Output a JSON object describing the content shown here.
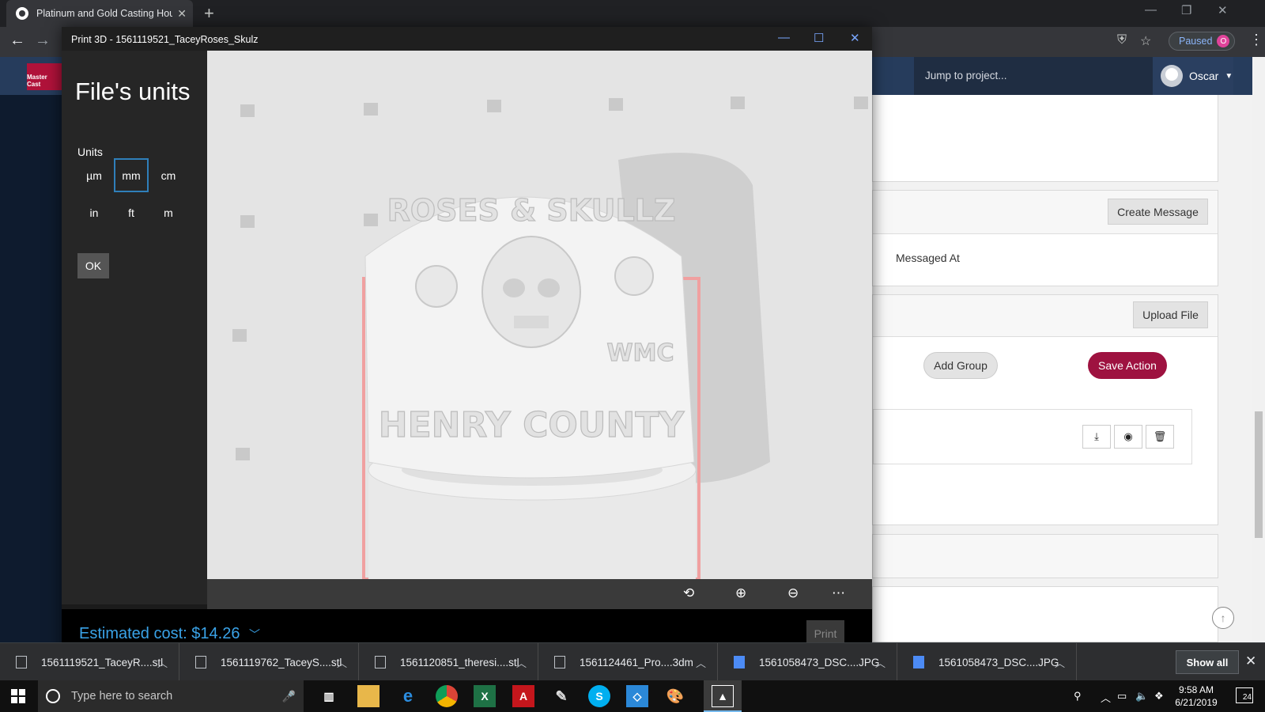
{
  "browser": {
    "tab_title": "Platinum and Gold Casting House",
    "paused_label": "Paused",
    "profile_badge": "O"
  },
  "site": {
    "logo_text": "Master Cast",
    "jump_placeholder": "Jump to project...",
    "user_name": "Oscar",
    "create_message_label": "Create Message",
    "messaged_at_label": "Messaged At",
    "upload_file_label": "Upload File",
    "add_group_label": "Add Group",
    "save_action_label": "Save Action",
    "save_color": "#9e1240"
  },
  "app": {
    "window_title": "Print 3D - 1561119521_TaceyRoses_Skulz",
    "panel_title": "File's units",
    "units_label": "Units",
    "units": [
      "µm",
      "mm",
      "cm",
      "in",
      "ft",
      "m"
    ],
    "selected_unit": "mm",
    "ok_label": "OK",
    "estimated_cost": "Estimated cost: $14.26",
    "print_label": "Print",
    "model_text_top": "ROSES & SKULLZ",
    "model_text_side": "WMC",
    "model_text_bottom": "HENRY COUNTY"
  },
  "downloads": {
    "items": [
      "1561119521_TaceyR....stl",
      "1561119762_TaceyS....stl",
      "1561120851_theresi....stl",
      "1561124461_Pro....3dm",
      "1561058473_DSC....JPG",
      "1561058473_DSC....JPG"
    ],
    "show_all_label": "Show all"
  },
  "taskbar": {
    "search_placeholder": "Type here to search",
    "time": "9:58 AM",
    "date": "6/21/2019",
    "notifications": "24"
  }
}
